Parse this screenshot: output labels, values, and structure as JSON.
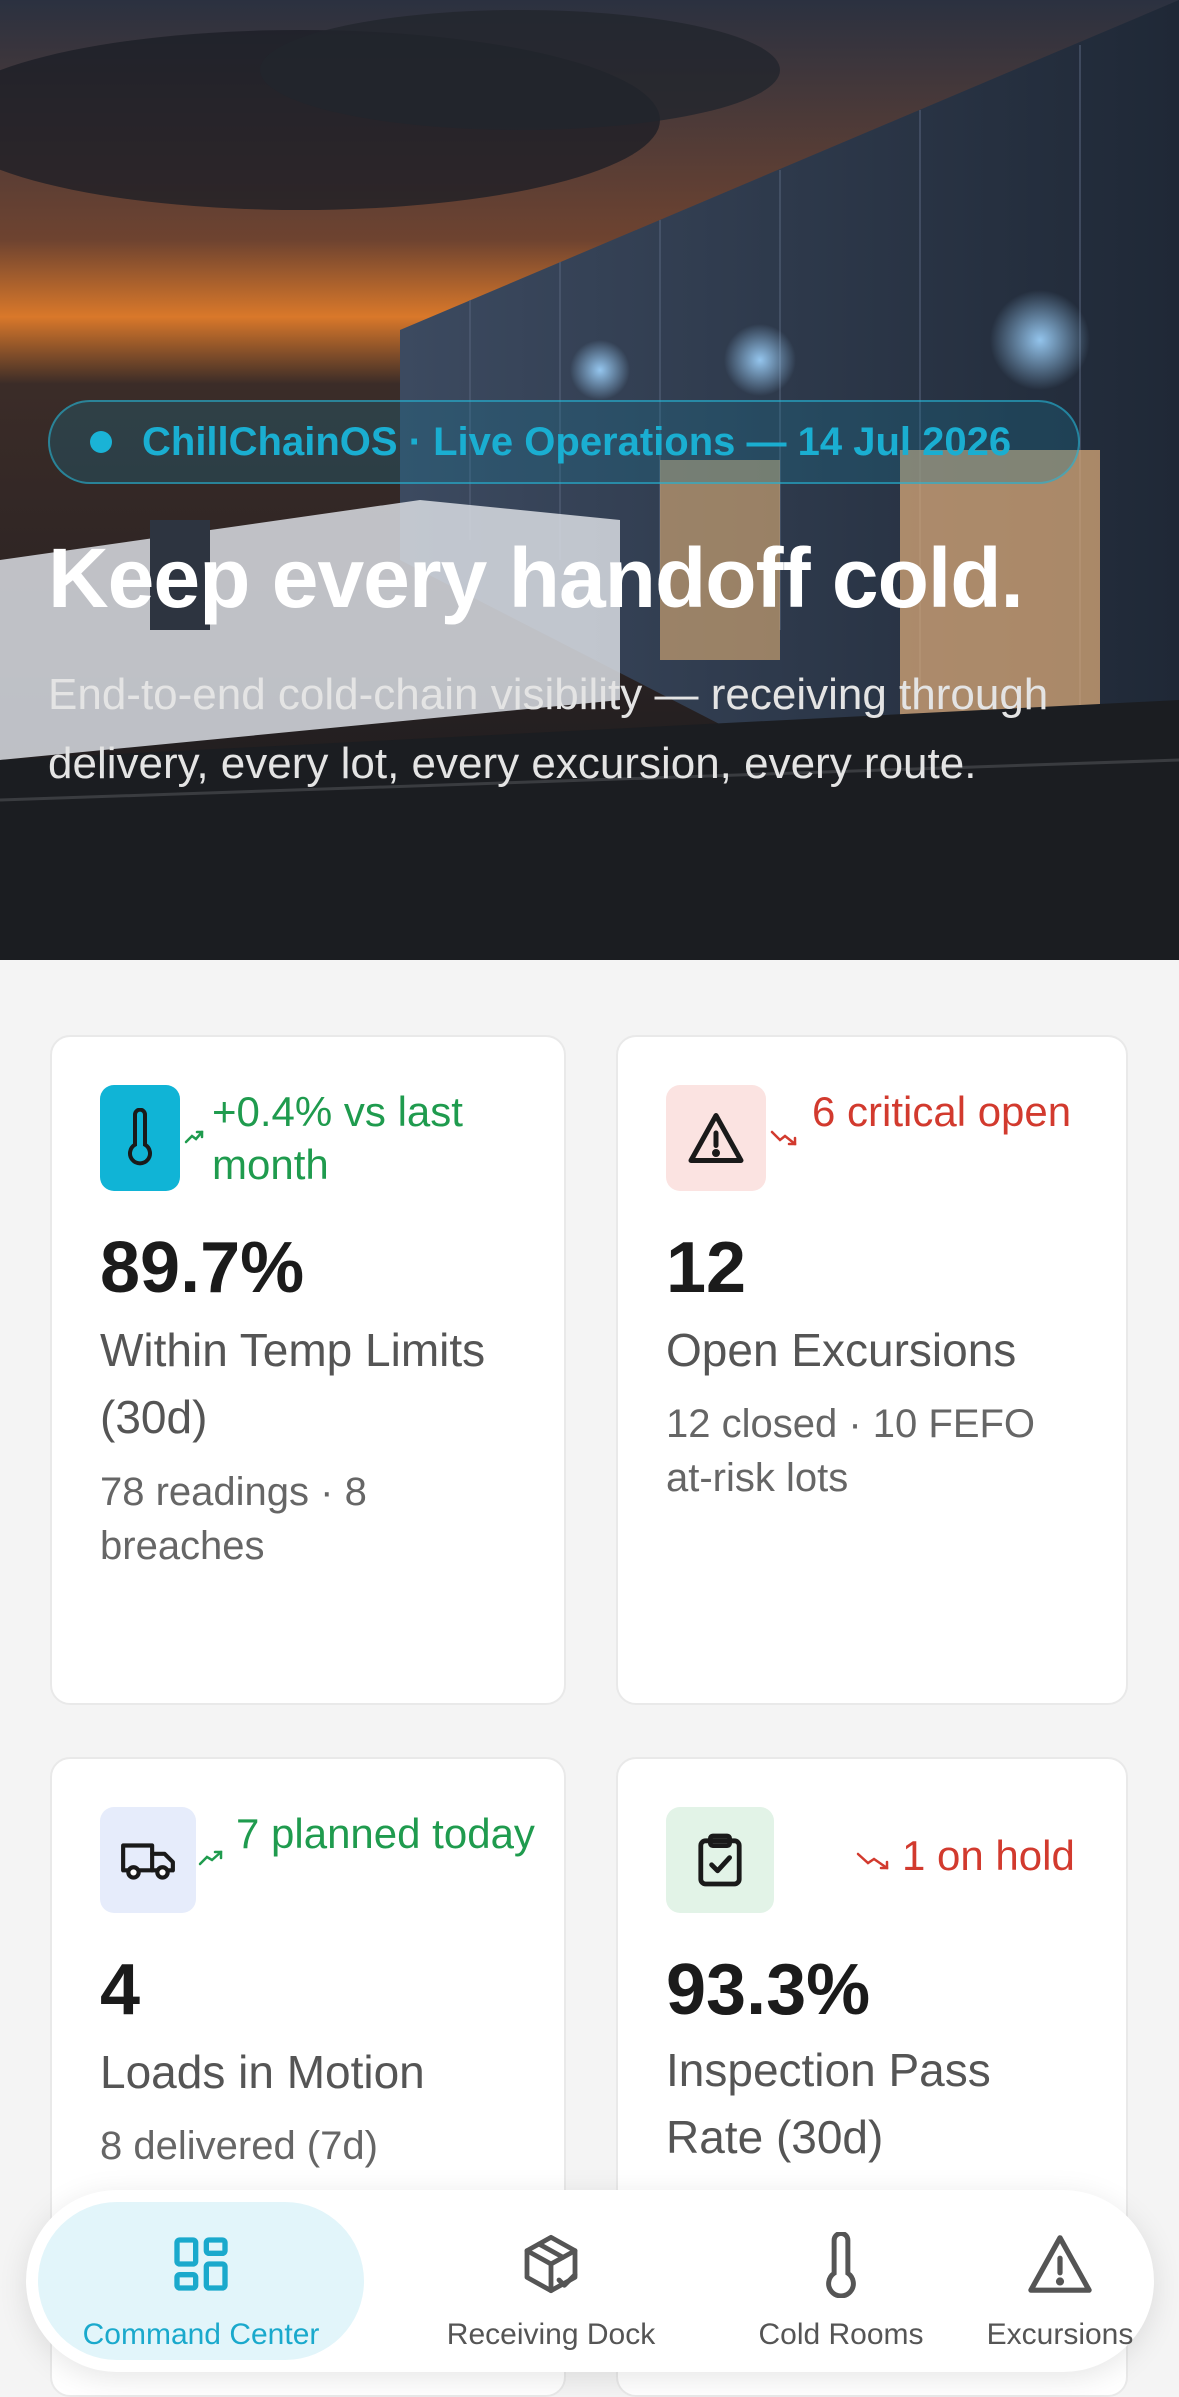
{
  "hero": {
    "pill_text": "ChillChainOS · Live Operations — 14 Jul 2026",
    "title": "Keep every handoff cold.",
    "subtitle": "End-to-end cold-chain visibility — receiving through delivery, every lot, every excursion, every route."
  },
  "cards": [
    {
      "icon": "thermometer-icon",
      "trend": "+0.4% vs last month",
      "trend_dir": "up",
      "metric": "89.7%",
      "label": "Within Temp Limits (30d)",
      "meta": "78 readings · 8 breaches"
    },
    {
      "icon": "warning-icon",
      "trend": "6 critical open",
      "trend_dir": "down",
      "metric": "12",
      "label": "Open Excursions",
      "meta": "12 closed · 10 FEFO at-risk lots"
    },
    {
      "icon": "truck-icon",
      "trend": "7 planned today",
      "trend_dir": "up",
      "metric": "4",
      "label": "Loads in Motion",
      "meta": "8 delivered (7d)"
    },
    {
      "icon": "clipboard-check-icon",
      "trend": "1 on hold",
      "trend_dir": "down",
      "metric": "93.3%",
      "label": "Inspection Pass Rate (30d)",
      "meta": ""
    }
  ],
  "nav": [
    {
      "label": "Command Center",
      "icon": "grid-icon",
      "active": true
    },
    {
      "label": "Receiving Dock",
      "icon": "package-check-icon",
      "active": false
    },
    {
      "label": "Cold Rooms",
      "icon": "thermometer-icon",
      "active": false
    },
    {
      "label": "Excursions",
      "icon": "warning-icon",
      "active": false
    }
  ],
  "colors": {
    "accent": "#1ab3d6",
    "up": "#1f9b4e",
    "down": "#d23a2e"
  }
}
